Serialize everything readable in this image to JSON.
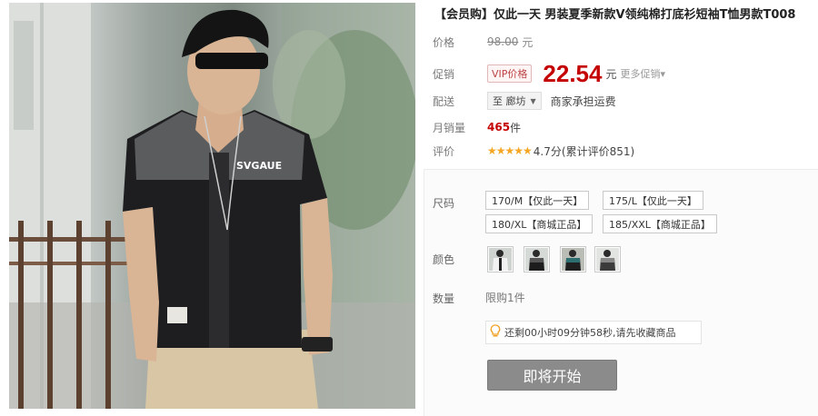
{
  "title": "【会员购】仅此一天 男装夏季新款V领纯棉打底衫短袖T恤男款T008",
  "price_row": {
    "label": "价格",
    "original": "98.00",
    "unit": "元"
  },
  "promo_row": {
    "label": "促销",
    "vip_tag": "VIP价格",
    "price": "22.54",
    "unit": "元",
    "more": "更多促销▾"
  },
  "delivery_row": {
    "label": "配送",
    "location": "至 廊坊",
    "shipping": "商家承担运费"
  },
  "sales_row": {
    "label": "月销量",
    "count": "465",
    "unit": "件"
  },
  "rating_row": {
    "label": "评价",
    "stars": "★★★★★",
    "score": "4.7分(累计评价851)"
  },
  "size": {
    "label": "尺码",
    "options": [
      "170/M【仅此一天】",
      "175/L【仅此一天】",
      "180/XL【商城正品】",
      "185/XXL【商城正品】"
    ]
  },
  "color": {
    "label": "颜色",
    "swatches": [
      "white-black",
      "black",
      "teal-black",
      "gray-black"
    ]
  },
  "quantity": {
    "label": "数量",
    "limit": "限购1件"
  },
  "notice": {
    "icon": "lightbulb-icon",
    "text": "还剩00小时09分钟58秒,请先收藏商品"
  },
  "start_button": "即将开始",
  "photo": {
    "shirt_print": "SVGAUE"
  },
  "colors": {
    "price_red": "#c40000",
    "button_gray": "#8b8b8b"
  }
}
